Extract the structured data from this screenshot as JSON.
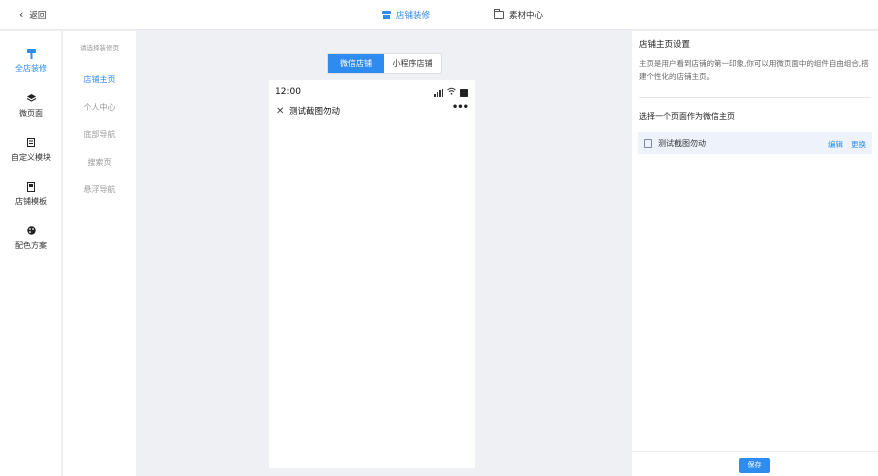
{
  "header": {
    "back_label": "返回",
    "tabs": [
      {
        "label": "店铺装修",
        "icon": "store-icon",
        "active": true
      },
      {
        "label": "素材中心",
        "icon": "folder-icon",
        "active": false
      }
    ]
  },
  "left_nav": {
    "items": [
      {
        "label": "全店装修",
        "icon": "paint-roller-icon",
        "active": true
      },
      {
        "label": "微页面",
        "icon": "layers-icon",
        "active": false
      },
      {
        "label": "自定义模块",
        "icon": "module-icon",
        "active": false
      },
      {
        "label": "店铺模板",
        "icon": "template-icon",
        "active": false
      },
      {
        "label": "配色方案",
        "icon": "palette-icon",
        "active": false
      }
    ]
  },
  "sub_nav": {
    "hint": "请选择装修页",
    "items": [
      {
        "label": "店铺主页",
        "active": true
      },
      {
        "label": "个人中心",
        "active": false
      },
      {
        "label": "底部导航",
        "active": false
      },
      {
        "label": "搜索页",
        "active": false
      },
      {
        "label": "悬浮导航",
        "active": false
      }
    ]
  },
  "preview": {
    "segments": [
      "微信店铺",
      "小程序店铺"
    ],
    "active_segment": "微信店铺",
    "time": "12:00",
    "page_title": "测试截图勿动",
    "more_label": "•••"
  },
  "right_panel": {
    "title": "店铺主页设置",
    "description": "主页是用户看到店铺的第一印象,你可以用微页面中的组件自由组合,搭建个性化的店铺主页。",
    "select_label": "选择一个页面作为微信主页",
    "selected_page": "测试截图勿动",
    "edit_label": "编辑",
    "change_label": "更换",
    "save_label": "保存"
  },
  "colors": {
    "accent": "#2e8cf0",
    "canvas_bg": "#eff0f4",
    "selected_row_bg": "#eef3fb"
  }
}
